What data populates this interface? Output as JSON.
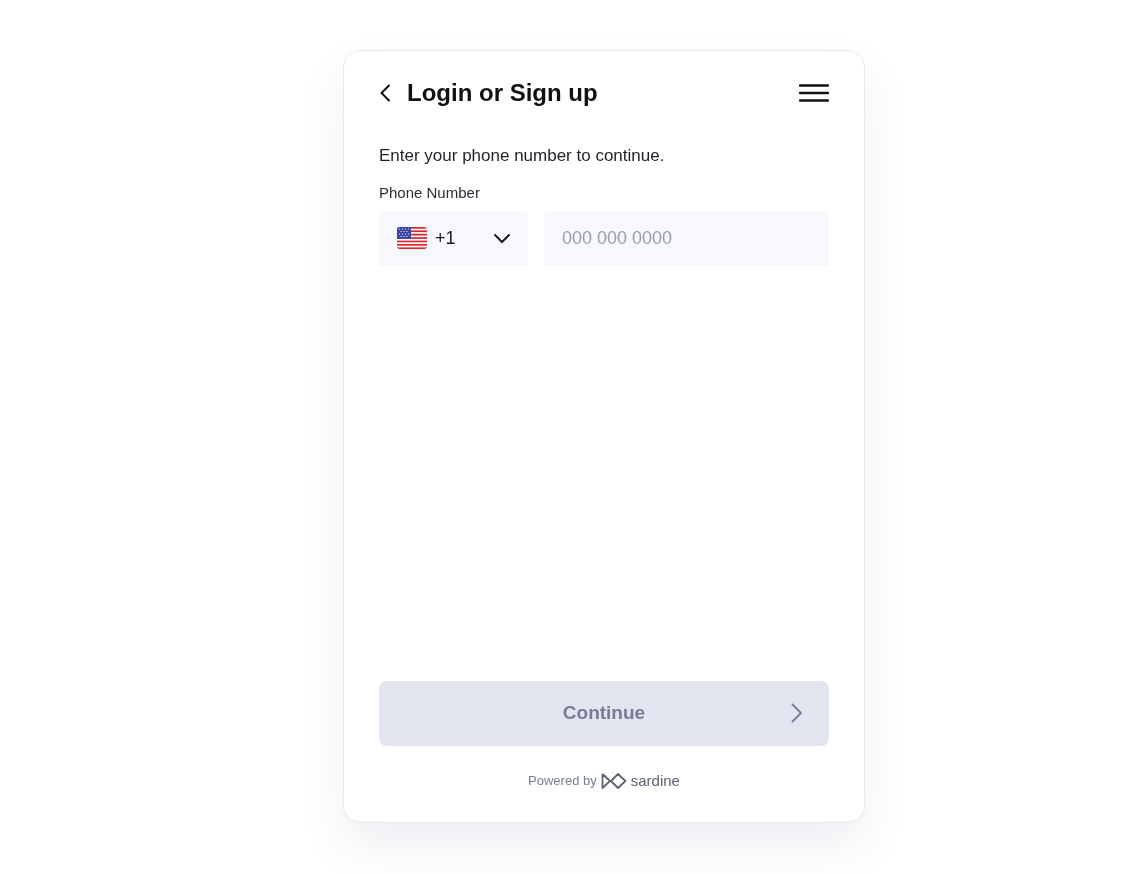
{
  "header": {
    "title": "Login or Sign up"
  },
  "form": {
    "prompt": "Enter your phone number to continue.",
    "phone_label": "Phone Number",
    "country_code": "+1",
    "phone_placeholder": "000 000 0000"
  },
  "continue_button": {
    "label": "Continue",
    "disabled": true
  },
  "footer": {
    "powered_by": "Powered by",
    "brand": "sardine"
  }
}
